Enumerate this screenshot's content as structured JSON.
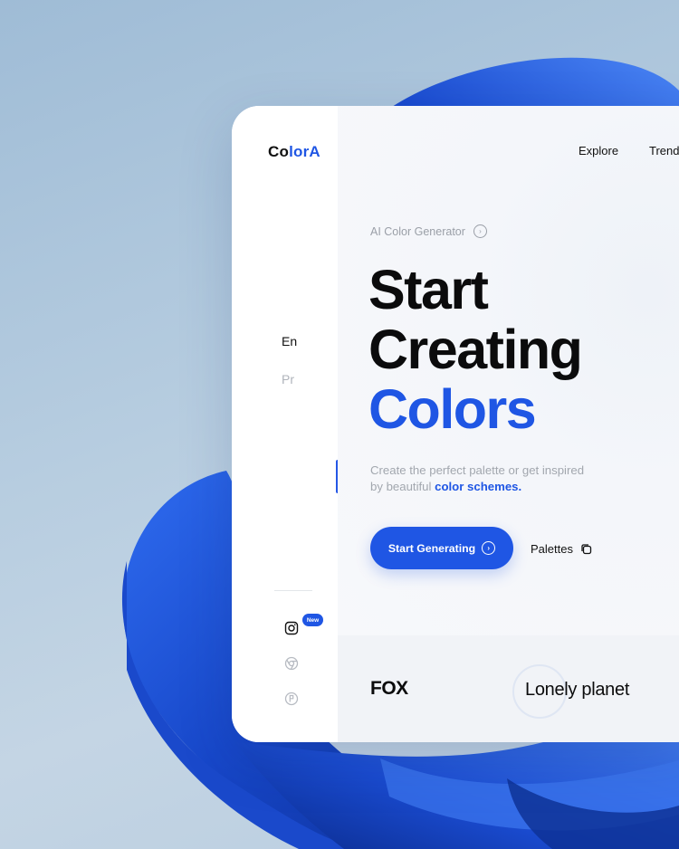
{
  "app": {
    "logo_prefix": "Co",
    "logo_mid": "lor",
    "logo_suffix": "A"
  },
  "nav": {
    "items": [
      {
        "label": "Explore"
      },
      {
        "label": "Trend"
      }
    ]
  },
  "sidebar": {
    "languages": [
      {
        "label": "En",
        "active": true
      },
      {
        "label": "Pr",
        "active": false
      }
    ],
    "social": [
      {
        "icon": "instagram-icon",
        "badge": "New"
      },
      {
        "icon": "chrome-icon"
      },
      {
        "icon": "figma-icon"
      }
    ]
  },
  "hero": {
    "eyebrow": "AI Color Generator",
    "line1": "Start",
    "line2": "Creating",
    "line3": "Colors",
    "subtitle_text": "Create the perfect palette or get inspired by beautiful ",
    "subtitle_highlight": "color schemes.",
    "cta_label": "Start Generating",
    "secondary_label": "Palettes"
  },
  "brands": {
    "items": [
      "FOX",
      "Lonely planet"
    ]
  },
  "colors": {
    "accent": "#1f56e4",
    "text": "#0b0b0c",
    "muted": "#9a9fa7"
  }
}
